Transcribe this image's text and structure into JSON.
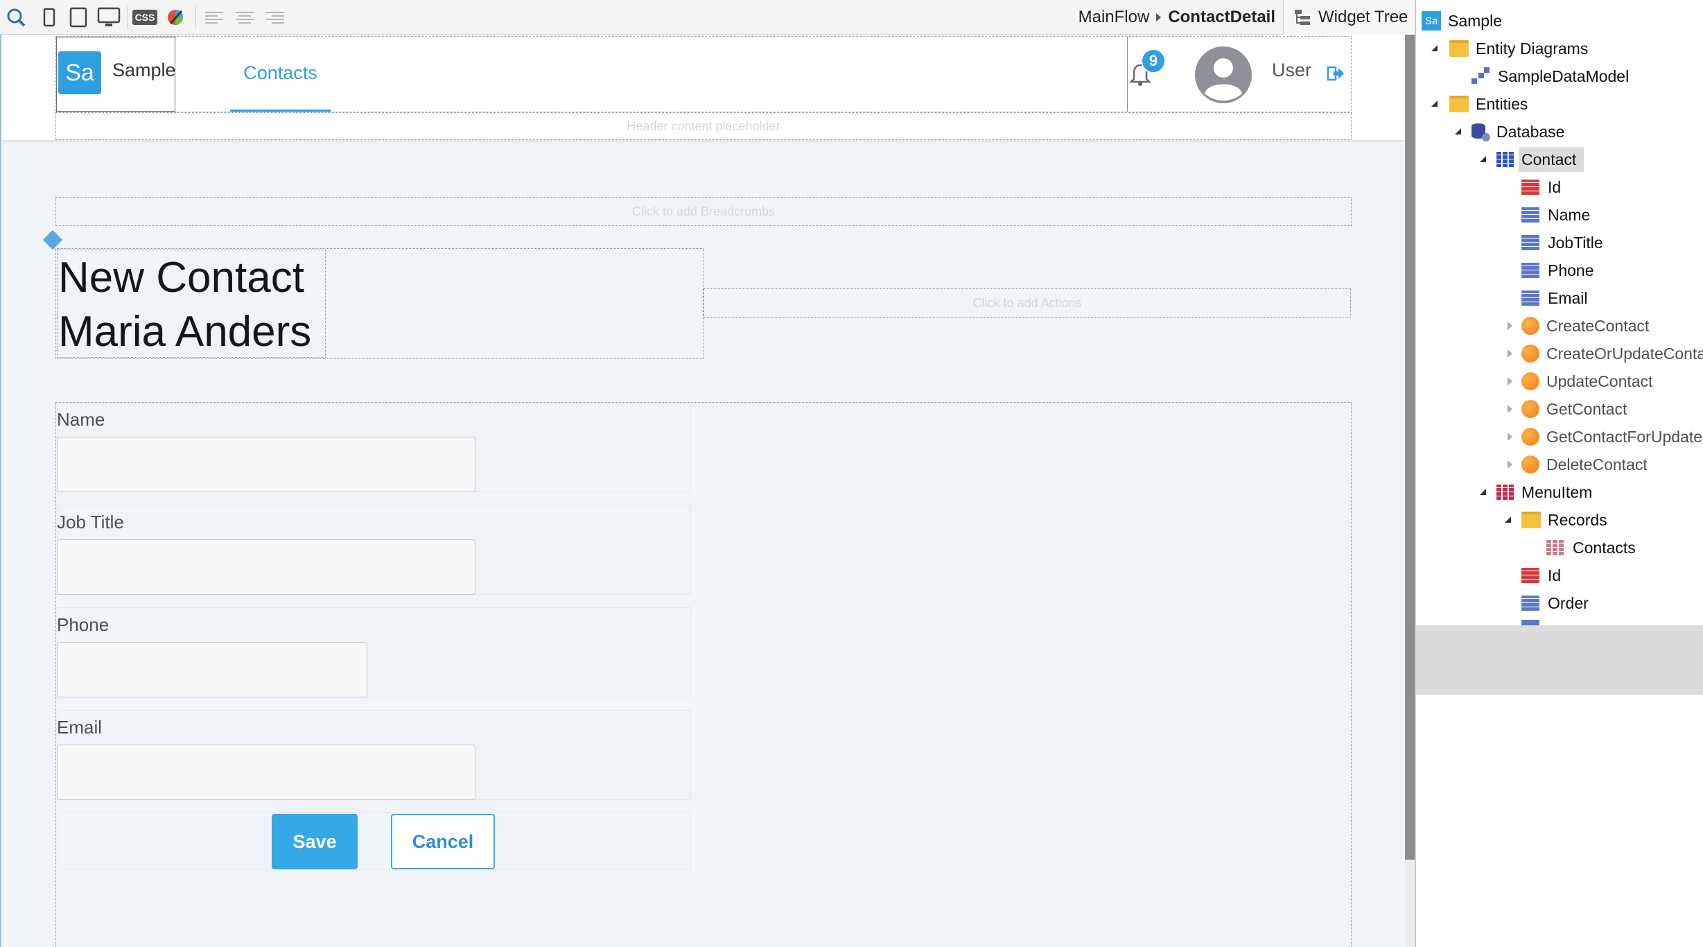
{
  "toolbar": {
    "breadcrumb_flow": "MainFlow",
    "breadcrumb_screen": "ContactDetail",
    "widget_tree_label": "Widget Tree",
    "css_label": "CSS"
  },
  "app_header": {
    "logo_text": "Sa",
    "app_name": "Sample",
    "menu_item": "Contacts",
    "notification_count": "9",
    "user_label": "User",
    "header_placeholder": "Header content placeholder"
  },
  "page": {
    "breadcrumbs_placeholder": "Click to add Breadcrumbs",
    "title_line1": "New Contact",
    "title_line2": "Maria Anders",
    "actions_placeholder": "Click to add Actions"
  },
  "form": {
    "fields": [
      {
        "label": "Name",
        "value": ""
      },
      {
        "label": "Job Title",
        "value": ""
      },
      {
        "label": "Phone",
        "value": ""
      },
      {
        "label": "Email",
        "value": ""
      }
    ],
    "save_label": "Save",
    "cancel_label": "Cancel"
  },
  "tree": {
    "root": "Sample",
    "root_icon_text": "Sa",
    "entity_diagrams": "Entity Diagrams",
    "data_model": "SampleDataModel",
    "entities": "Entities",
    "database": "Database",
    "contact": "Contact",
    "contact_attributes": [
      "Id",
      "Name",
      "JobTitle",
      "Phone",
      "Email"
    ],
    "contact_actions": [
      "CreateContact",
      "CreateOrUpdateContact",
      "UpdateContact",
      "GetContact",
      "GetContactForUpdate",
      "DeleteContact"
    ],
    "menuitem": "MenuItem",
    "records": "Records",
    "records_child": "Contacts",
    "menuitem_attributes": [
      "Id",
      "Order"
    ]
  },
  "colors": {
    "accent": "#2f9fe0",
    "canvas_bg": "#f0f4f8",
    "save_button_bg": "#35a9e6",
    "tree_selected_bg": "#dcdcdc"
  }
}
